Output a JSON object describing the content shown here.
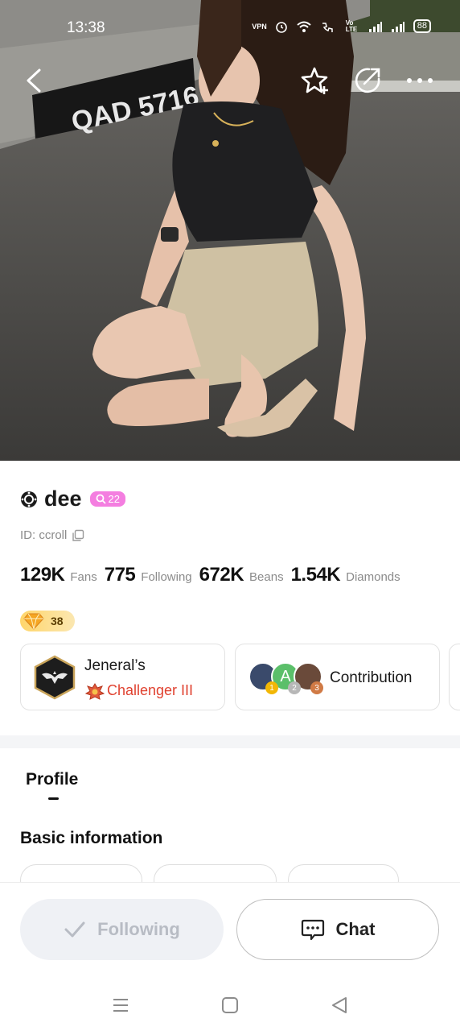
{
  "status_bar": {
    "time": "13:38",
    "vpn": "VPN",
    "volte": "Vo LTE",
    "battery": "88"
  },
  "hero": {
    "plate_text": "QAD 5716",
    "icons": [
      "back-arrow-icon",
      "star-add-icon",
      "share-icon",
      "more-icon"
    ]
  },
  "profile": {
    "name": "dee",
    "level": "22",
    "id_label": "ID: ccroll",
    "stats": [
      {
        "value": "129K",
        "label": "Fans"
      },
      {
        "value": "775",
        "label": "Following"
      },
      {
        "value": "672K",
        "label": "Beans"
      },
      {
        "value": "1.54K",
        "label": "Diamonds"
      }
    ],
    "diamond_level": "38"
  },
  "cards": {
    "jeneral_title": "Jeneral’s",
    "jeneral_rank": "Challenger III",
    "contribution_label": "Contribution",
    "contributor_ranks": [
      "1",
      "2",
      "3"
    ],
    "contributor_initial": "A"
  },
  "tabs": {
    "profile": "Profile"
  },
  "sections": {
    "basic_info": "Basic information"
  },
  "actions": {
    "following": "Following",
    "chat": "Chat"
  },
  "colors": {
    "level_chip": "#f47ee0",
    "rank_text": "#e0412f",
    "following_bg": "#eff1f5",
    "diamond_chip": "#ffd66b"
  }
}
